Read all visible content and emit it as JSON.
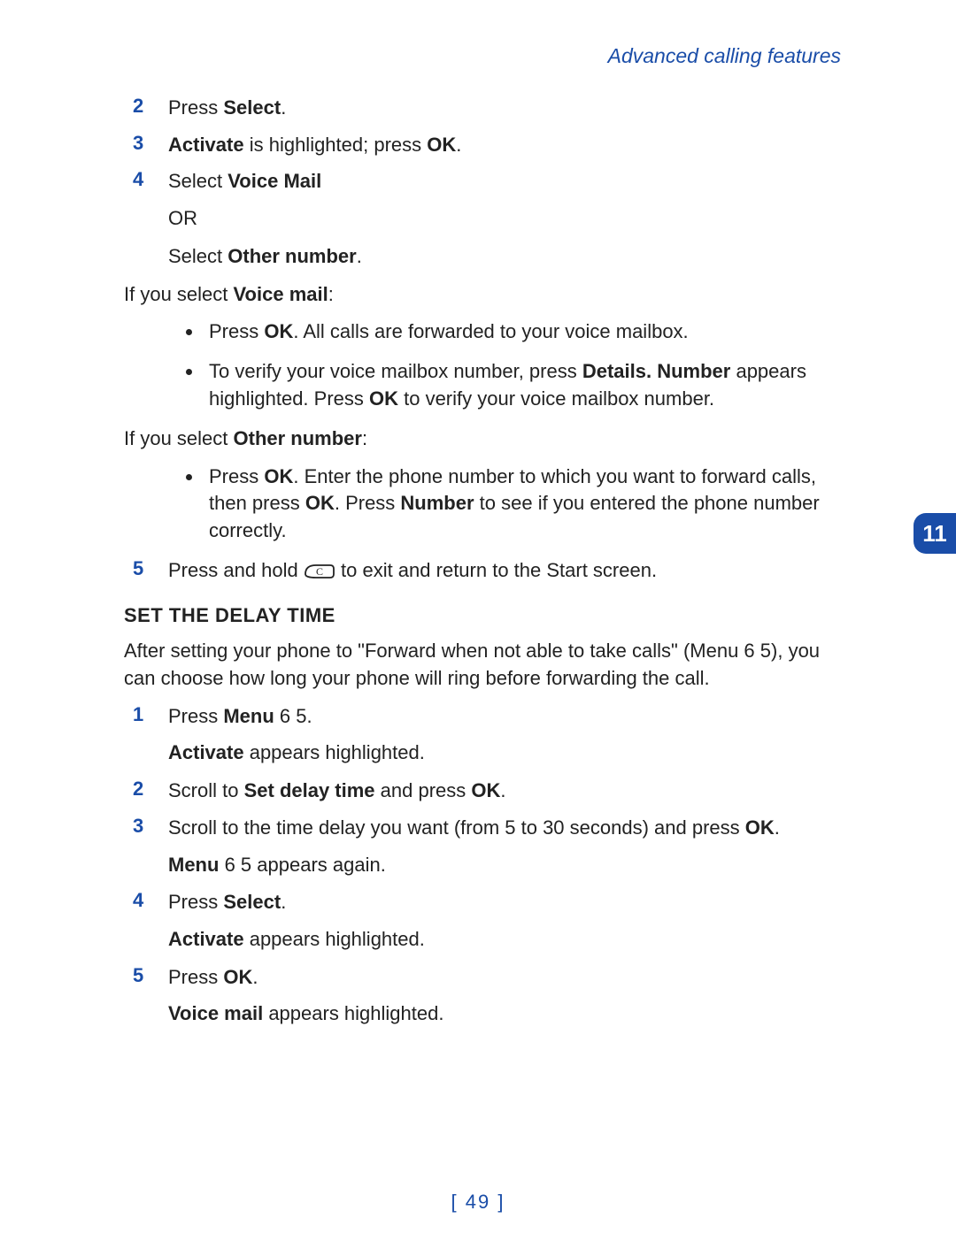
{
  "header": "Advanced calling features",
  "tab_number": "11",
  "steps_a": [
    {
      "n": "2",
      "runs": [
        [
          "Press ",
          ""
        ],
        [
          "Select",
          "bold"
        ],
        [
          ".",
          ""
        ]
      ]
    },
    {
      "n": "3",
      "runs": [
        [
          "Activate",
          "bold"
        ],
        [
          " is highlighted; press ",
          ""
        ],
        [
          "OK",
          "bold"
        ],
        [
          ".",
          ""
        ]
      ]
    },
    {
      "n": "4",
      "runs": [
        [
          "Select ",
          ""
        ],
        [
          "Voice Mail",
          "bold"
        ]
      ]
    }
  ],
  "or_line": "OR",
  "select_other": [
    [
      "Select ",
      ""
    ],
    [
      "Other number",
      "bold"
    ],
    [
      ".",
      ""
    ]
  ],
  "if_voice": [
    [
      "If you select ",
      ""
    ],
    [
      "Voice mail",
      "bold"
    ],
    [
      ":",
      ""
    ]
  ],
  "voice_bullets": [
    [
      [
        "Press ",
        ""
      ],
      [
        "OK",
        "bold"
      ],
      [
        ". All calls are forwarded to your voice mailbox.",
        ""
      ]
    ],
    [
      [
        "To verify your voice mailbox number, press ",
        ""
      ],
      [
        "Details. Number",
        "bold"
      ],
      [
        " appears highlighted. Press ",
        ""
      ],
      [
        "OK",
        "bold"
      ],
      [
        " to verify your voice mailbox number.",
        ""
      ]
    ]
  ],
  "if_other": [
    [
      "If you select ",
      ""
    ],
    [
      "Other number",
      "bold"
    ],
    [
      ":",
      ""
    ]
  ],
  "other_bullets": [
    [
      [
        "Press ",
        ""
      ],
      [
        "OK",
        "bold"
      ],
      [
        ". Enter the phone number to which you want to forward calls, then press ",
        ""
      ],
      [
        "OK",
        "bold"
      ],
      [
        ". Press ",
        ""
      ],
      [
        "Number",
        "bold"
      ],
      [
        " to see if you entered the phone number correctly.",
        ""
      ]
    ]
  ],
  "step5": {
    "n": "5",
    "before": "Press and hold ",
    "after": " to exit and return to the Start screen."
  },
  "section_heading": "SET THE DELAY TIME",
  "delay_intro": "After setting your phone to \"Forward when not able to take calls\" (Menu 6 5), you can choose how long your phone will ring before forwarding the call.",
  "steps_b": [
    {
      "n": "1",
      "line": [
        [
          "Press ",
          ""
        ],
        [
          "Menu",
          "bold"
        ],
        [
          " 6 5.",
          ""
        ]
      ],
      "sub": [
        [
          "Activate",
          "bold"
        ],
        [
          " appears highlighted.",
          ""
        ]
      ]
    },
    {
      "n": "2",
      "line": [
        [
          "Scroll to ",
          ""
        ],
        [
          "Set delay time",
          "bold"
        ],
        [
          " and press ",
          ""
        ],
        [
          "OK",
          "bold"
        ],
        [
          ".",
          ""
        ]
      ]
    },
    {
      "n": "3",
      "line": [
        [
          "Scroll to the time delay you want (from 5 to 30 seconds) and press ",
          ""
        ],
        [
          "OK",
          "bold"
        ],
        [
          ".",
          ""
        ]
      ],
      "sub": [
        [
          "Menu",
          "bold"
        ],
        [
          " 6 5 appears again.",
          ""
        ]
      ]
    },
    {
      "n": "4",
      "line": [
        [
          "Press ",
          ""
        ],
        [
          "Select",
          "bold"
        ],
        [
          ".",
          ""
        ]
      ],
      "sub": [
        [
          "Activate",
          "bold"
        ],
        [
          " appears highlighted.",
          ""
        ]
      ]
    },
    {
      "n": "5",
      "line": [
        [
          "Press ",
          ""
        ],
        [
          "OK",
          "bold"
        ],
        [
          ".",
          ""
        ]
      ],
      "sub": [
        [
          "Voice mail",
          "bold"
        ],
        [
          " appears highlighted.",
          ""
        ]
      ]
    }
  ],
  "page_number": "[ 49 ]"
}
